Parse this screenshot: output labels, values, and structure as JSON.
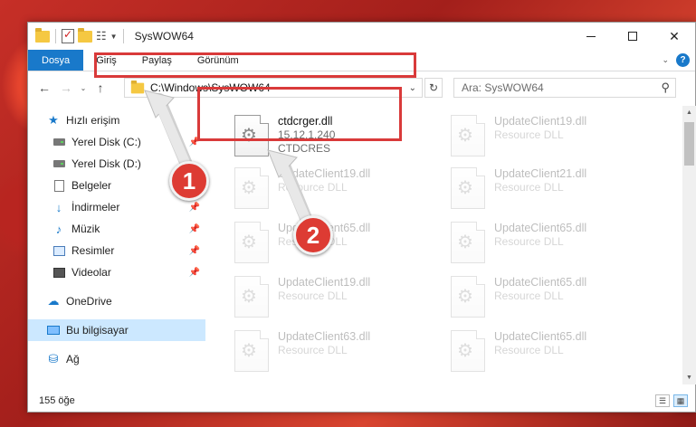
{
  "titlebar": {
    "title": "SysWOW64",
    "minimize_label": "",
    "maximize_label": "",
    "close_label": "✕"
  },
  "ribbon": {
    "tabs": [
      "Dosya",
      "Giriş",
      "Paylaş",
      "Görünüm"
    ],
    "help": "?"
  },
  "address": {
    "path": "C:\\Windows\\SysWOW64"
  },
  "search": {
    "placeholder": "Ara: SysWOW64"
  },
  "sidebar": {
    "items": [
      {
        "label": "Hızlı erişim",
        "icon": "star-icon"
      },
      {
        "label": "Yerel Disk (C:)",
        "icon": "drive-icon"
      },
      {
        "label": "Yerel Disk (D:)",
        "icon": "drive-icon"
      },
      {
        "label": "Belgeler",
        "icon": "document-icon"
      },
      {
        "label": "İndirmeler",
        "icon": "download-icon"
      },
      {
        "label": "Müzik",
        "icon": "music-icon"
      },
      {
        "label": "Resimler",
        "icon": "pictures-icon"
      },
      {
        "label": "Videolar",
        "icon": "video-icon"
      },
      {
        "label": "OneDrive",
        "icon": "cloud-icon"
      },
      {
        "label": "Bu bilgisayar",
        "icon": "computer-icon"
      },
      {
        "label": "Ağ",
        "icon": "network-icon"
      }
    ]
  },
  "files": [
    {
      "name": "ctdcrger.dll",
      "line2": "15.12.1.240",
      "line3": "CTDCRES"
    },
    {
      "name": "UpdateClient19.dll",
      "line2": "Resource DLL"
    },
    {
      "name": "UpdateClient19.dll",
      "line2": "Resource DLL"
    },
    {
      "name": "UpdateClient21.dll",
      "line2": "Resource DLL"
    },
    {
      "name": "UpdateClient65.dll",
      "line2": "Resource DLL"
    },
    {
      "name": "UpdateClient65.dll",
      "line2": "Resource DLL"
    },
    {
      "name": "UpdateClient19.dll",
      "line2": "Resource DLL"
    },
    {
      "name": "UpdateClient65.dll",
      "line2": "Resource DLL"
    },
    {
      "name": "UpdateClient63.dll",
      "line2": "Resource DLL"
    },
    {
      "name": "UpdateClient65.dll",
      "line2": "Resource DLL"
    }
  ],
  "status": {
    "count": "155 öğe"
  },
  "callouts": [
    "1",
    "2"
  ],
  "colors": {
    "accent": "#1979ca",
    "highlight": "#d93a3a",
    "badge": "#dd3b33"
  }
}
